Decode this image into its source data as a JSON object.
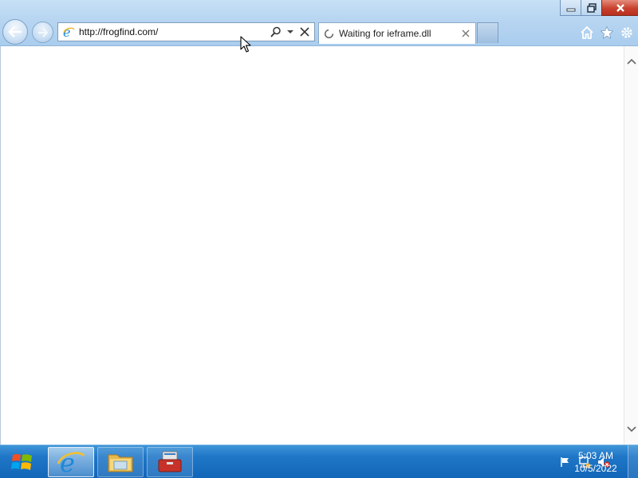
{
  "browser": {
    "address": {
      "url": "http://frogfind.com/",
      "site_icon": "ie-page-icon",
      "search_icon": "search-icon",
      "dropdown_icon": "chevron-down-icon",
      "stop_icon": "close-icon"
    },
    "tabs": [
      {
        "title": "Waiting for ieframe.dll",
        "state_icon": "loading-spinner-icon"
      }
    ],
    "toolbar_right": [
      "home-icon",
      "star-icon",
      "gear-icon"
    ],
    "window_controls": [
      "minimize",
      "restore",
      "close"
    ]
  },
  "taskbar": {
    "pinned": [
      "internet-explorer",
      "file-explorer",
      "toolbox"
    ],
    "active": "internet-explorer",
    "tray_icons": [
      "action-center-flag-icon",
      "network-icon",
      "volume-muted-icon"
    ],
    "clock": {
      "time": "5:03 AM",
      "date": "10/5/2022"
    }
  },
  "colors": {
    "taskbar": "#1f76c7",
    "titlebar": "#b7d5f1",
    "close_button": "#c7412e"
  }
}
